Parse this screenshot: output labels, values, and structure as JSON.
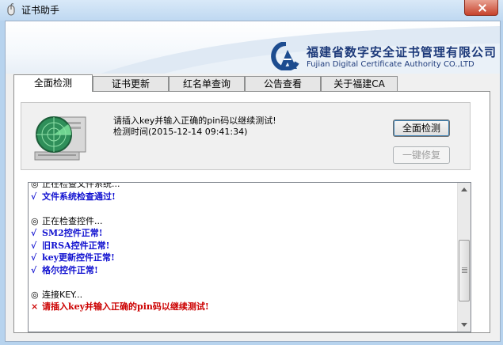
{
  "window": {
    "title": "证书助手"
  },
  "banner": {
    "org_cn": "福建省数字安全证书管理有限公司",
    "org_en": "Fujian Digital Certificate Authority CO.,LTD"
  },
  "tabs": [
    {
      "label": "全面检测",
      "active": true
    },
    {
      "label": "证书更新",
      "active": false
    },
    {
      "label": "红名单查询",
      "active": false
    },
    {
      "label": "公告查看",
      "active": false
    },
    {
      "label": "关于福建CA",
      "active": false
    }
  ],
  "status": {
    "message": "请插入key并输入正确的pin码以继续测试!",
    "time_label": "检测时间(2015-12-14 09:41:34)"
  },
  "buttons": {
    "full_check": "全面检测",
    "repair": "一键修复"
  },
  "log": [
    {
      "type": "normal",
      "mark": "◎",
      "text": "正在检查文件系统..."
    },
    {
      "type": "ok",
      "mark": "√",
      "text": "文件系统检查通过!"
    },
    {
      "type": "blank",
      "mark": "",
      "text": ""
    },
    {
      "type": "normal",
      "mark": "◎",
      "text": "正在检查控件..."
    },
    {
      "type": "ok",
      "mark": "√",
      "text": "SM2控件正常!"
    },
    {
      "type": "ok",
      "mark": "√",
      "text": "旧RSA控件正常!"
    },
    {
      "type": "ok",
      "mark": "√",
      "text": "key更新控件正常!"
    },
    {
      "type": "ok",
      "mark": "√",
      "text": "格尔控件正常!"
    },
    {
      "type": "blank",
      "mark": "",
      "text": ""
    },
    {
      "type": "normal",
      "mark": "◎",
      "text": "连接KEY..."
    },
    {
      "type": "err",
      "mark": "×",
      "text": "请插入key并输入正确的pin码以继续测试!"
    }
  ],
  "colors": {
    "ok": "#1010d0",
    "error": "#cc0000",
    "brand": "#1d3a7a"
  }
}
